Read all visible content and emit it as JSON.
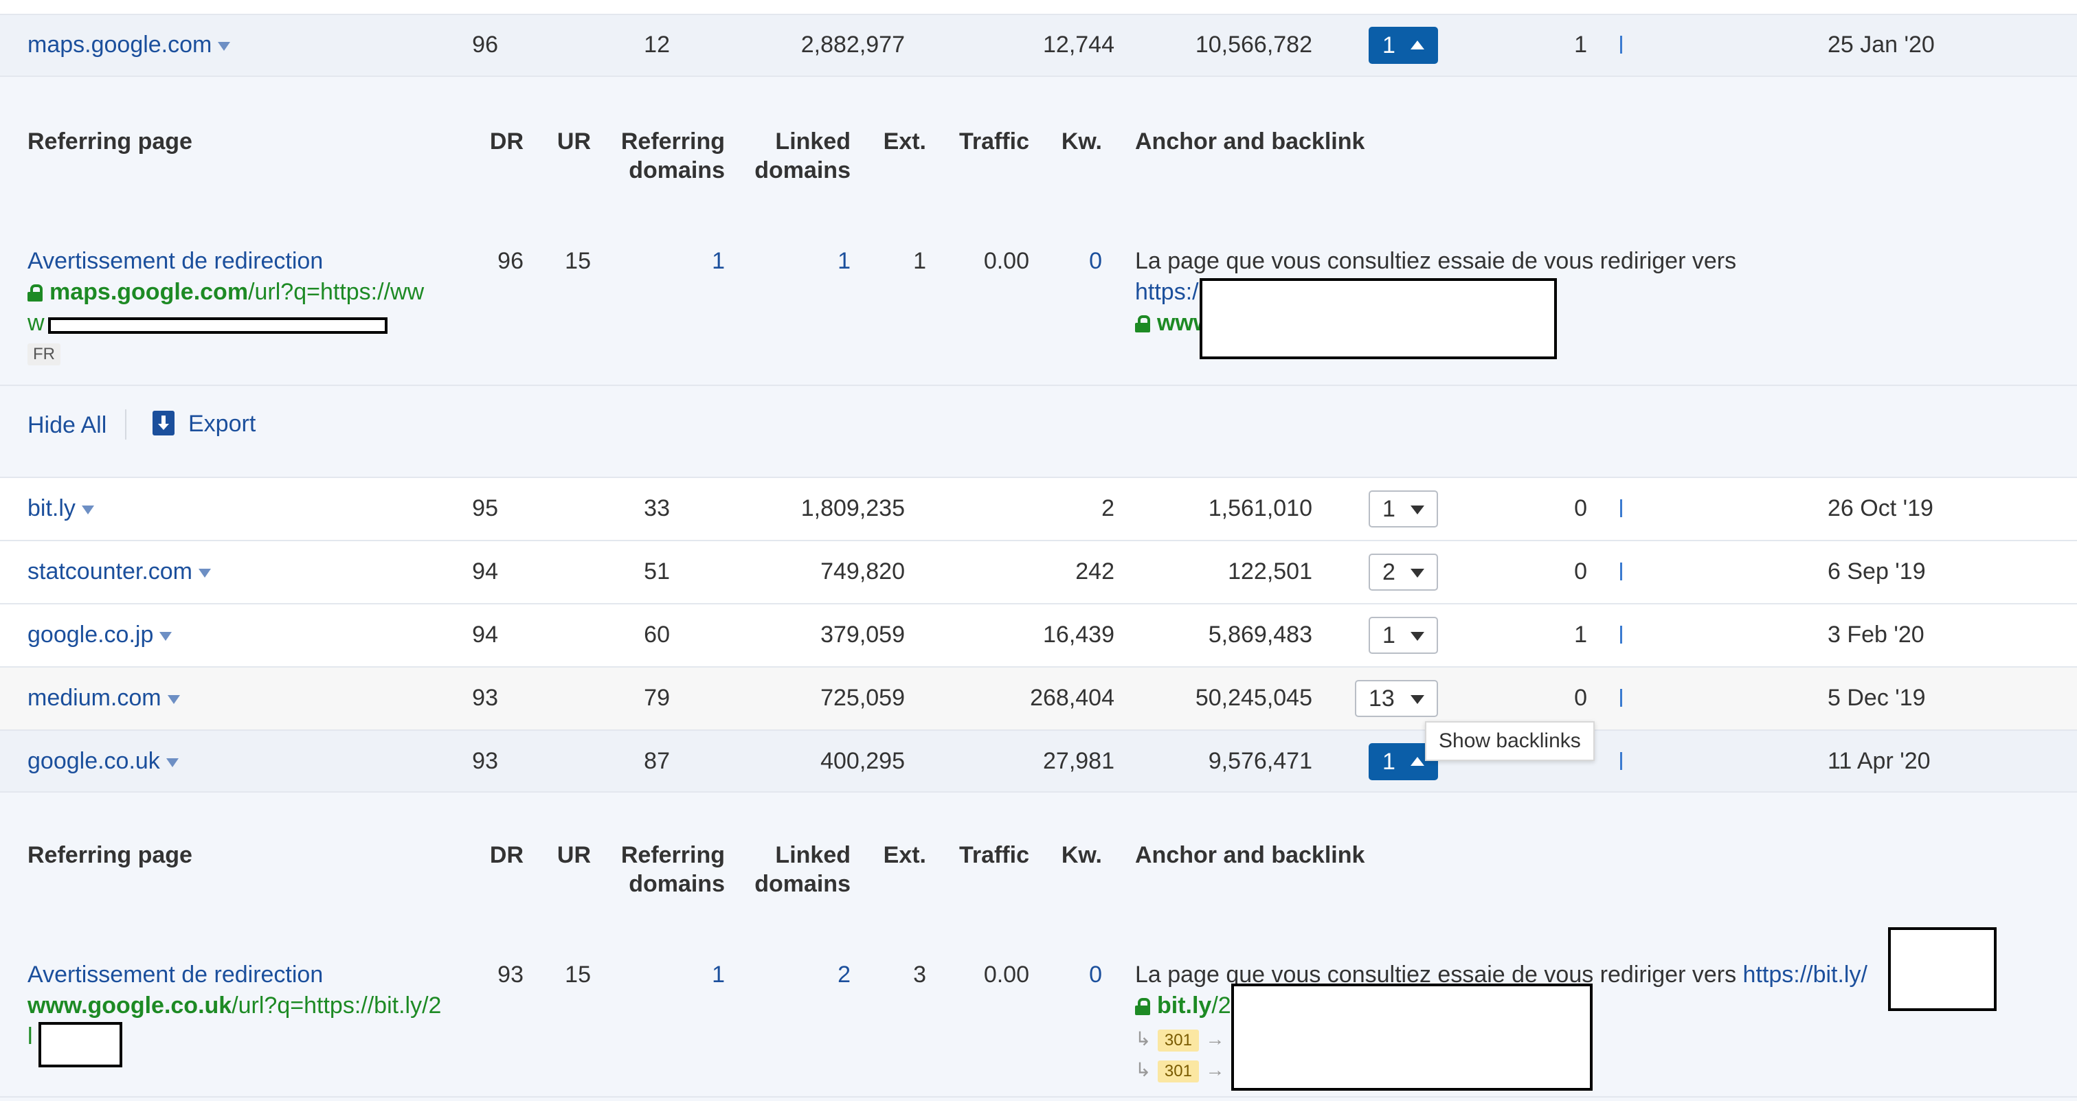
{
  "domain_rows": [
    {
      "domain": "maps.google.com",
      "dr": "96",
      "ur": "12",
      "ref_domains": "2,882,977",
      "linked_domains": "12,744",
      "traffic": "10,566,782",
      "backlinks": "1",
      "new": "1",
      "date": "25 Jan '20"
    },
    {
      "domain": "bit.ly",
      "dr": "95",
      "ur": "33",
      "ref_domains": "1,809,235",
      "linked_domains": "2",
      "traffic": "1,561,010",
      "backlinks": "1",
      "new": "0",
      "date": "26 Oct '19"
    },
    {
      "domain": "statcounter.com",
      "dr": "94",
      "ur": "51",
      "ref_domains": "749,820",
      "linked_domains": "242",
      "traffic": "122,501",
      "backlinks": "2",
      "new": "0",
      "date": "6 Sep '19"
    },
    {
      "domain": "google.co.jp",
      "dr": "94",
      "ur": "60",
      "ref_domains": "379,059",
      "linked_domains": "16,439",
      "traffic": "5,869,483",
      "backlinks": "1",
      "new": "1",
      "date": "3 Feb '20"
    },
    {
      "domain": "medium.com",
      "dr": "93",
      "ur": "79",
      "ref_domains": "725,059",
      "linked_domains": "268,404",
      "traffic": "50,245,045",
      "backlinks": "13",
      "new": "0",
      "date": "5 Dec '19"
    },
    {
      "domain": "google.co.uk",
      "dr": "93",
      "ur": "87",
      "ref_domains": "400,295",
      "linked_domains": "27,981",
      "traffic": "9,576,471",
      "backlinks": "1",
      "new": "",
      "date": "11 Apr '20"
    }
  ],
  "sub_header": {
    "referring_page": "Referring page",
    "dr": "DR",
    "ur": "UR",
    "ref_domains_1": "Referring",
    "ref_domains_2": "domains",
    "linked_domains_1": "Linked",
    "linked_domains_2": "domains",
    "ext": "Ext.",
    "traffic": "Traffic",
    "kw": "Kw.",
    "anchor": "Anchor and backlink"
  },
  "backlink_1": {
    "title": "Avertissement de redirection",
    "url_bold": "maps.google.com",
    "url_rest": "/url?q=https://ww",
    "url_line2": "w",
    "lang": "FR",
    "dr": "96",
    "ur": "15",
    "ref_domains": "1",
    "linked_domains": "1",
    "ext": "1",
    "traffic": "0.00",
    "kw": "0",
    "anchor_text": "La page que vous consultiez essaie de vous rediriger vers",
    "anchor_link": "https:/",
    "target_host": "www"
  },
  "actions": {
    "hide_all": "Hide All",
    "export": "Export"
  },
  "tooltip": "Show backlinks",
  "backlink_2": {
    "title": "Avertissement de redirection",
    "url_bold": "www.google.co.uk",
    "url_rest": "/url?q=https://bit.ly/2",
    "url_line2": "l",
    "dr": "93",
    "ur": "15",
    "ref_domains": "1",
    "linked_domains": "2",
    "ext": "3",
    "traffic": "0.00",
    "kw": "0",
    "anchor_text": "La page que vous consultiez essaie de vous rediriger vers",
    "anchor_link": "https://bit.ly/",
    "target_host": "bit.ly",
    "target_rest": "/2",
    "redirect_code_1": "301",
    "redirect_code_2": "301"
  }
}
